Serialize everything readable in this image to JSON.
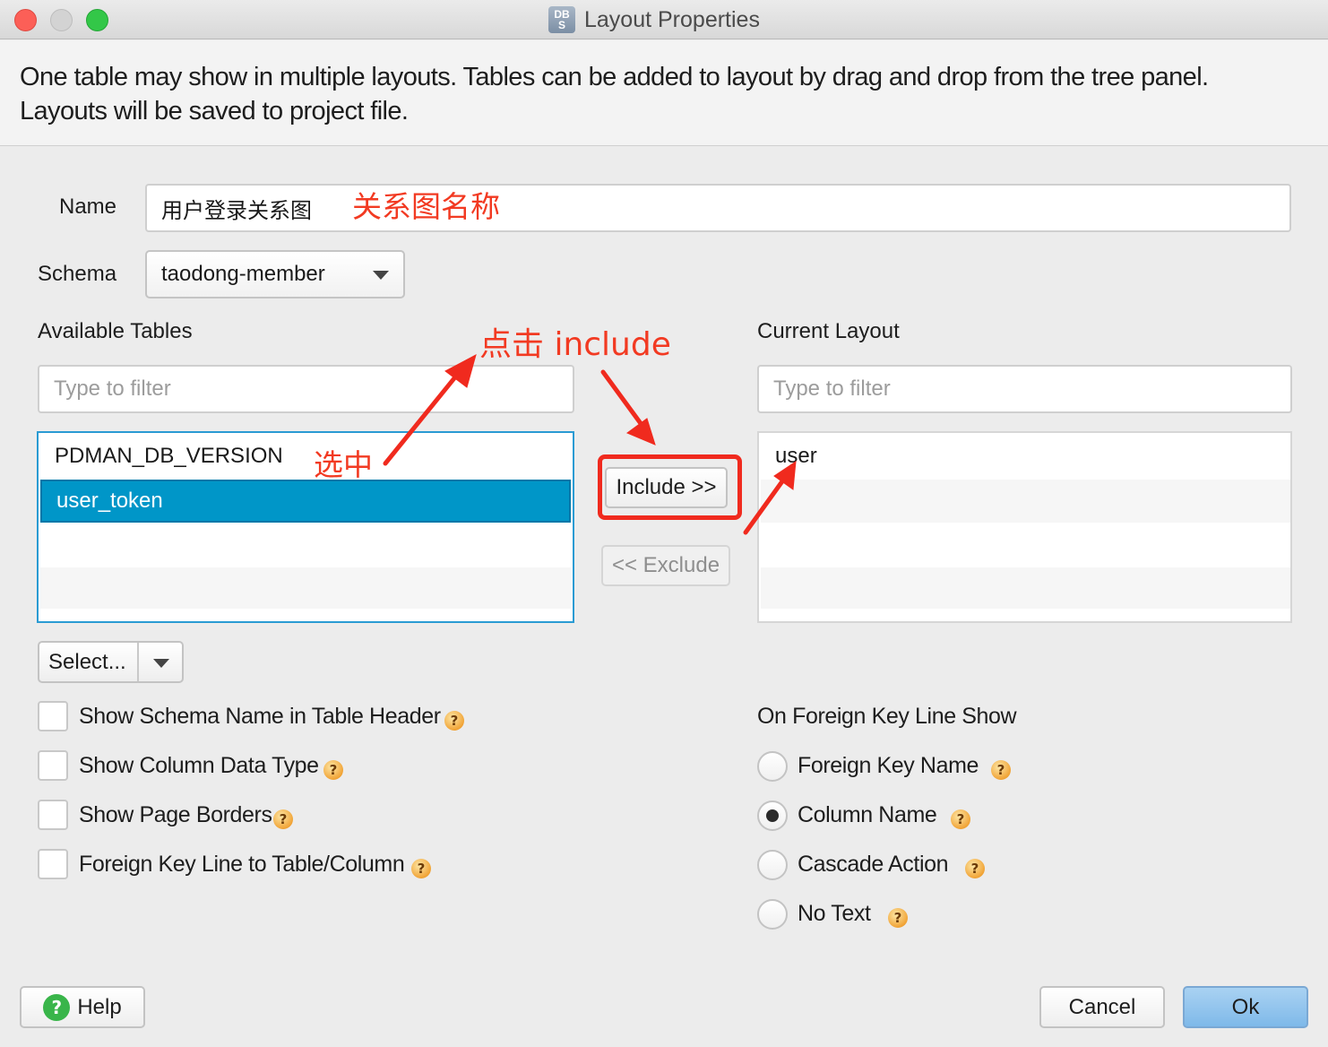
{
  "window": {
    "title": "Layout Properties",
    "app_icon_text_top": "DB",
    "app_icon_text_bottom": "S"
  },
  "description": {
    "line1": "One table may show in multiple layouts. Tables can be added to layout by drag and drop from the tree panel.",
    "line2": "Layouts will be saved to project file."
  },
  "name_field": {
    "label": "Name",
    "value": "用户登录关系图"
  },
  "schema": {
    "label": "Schema",
    "selected": "taodong-member"
  },
  "available_tables": {
    "label": "Available Tables",
    "filter_placeholder": "Type to filter",
    "items": [
      "PDMAN_DB_VERSION",
      "user_token"
    ],
    "selected_index": 1
  },
  "current_layout": {
    "label": "Current Layout",
    "filter_placeholder": "Type to filter",
    "items": [
      "user"
    ]
  },
  "buttons": {
    "include": "Include >>",
    "exclude": "<< Exclude",
    "select": "Select...",
    "help": "Help",
    "cancel": "Cancel",
    "ok": "Ok"
  },
  "options": {
    "show_schema_name": "Show Schema Name in Table Header",
    "show_column_data_type": "Show Column Data Type",
    "show_page_borders": "Show Page Borders",
    "fk_line_to_table_column": "Foreign Key Line to Table/Column"
  },
  "fk_line_show": {
    "label": "On Foreign Key Line Show",
    "options": [
      "Foreign Key Name",
      "Column Name",
      "Cascade Action",
      "No Text"
    ],
    "selected": "Column Name"
  },
  "annotations": {
    "name_note": "关系图名称",
    "click_include": "点击 include",
    "select_note": "选中"
  },
  "icons": [
    "help-icon",
    "chevron-down-icon",
    "question-icon"
  ],
  "colors": {
    "selection": "#0096c8",
    "annotation": "#f23a22",
    "ok_button": "#8fc3ee"
  }
}
